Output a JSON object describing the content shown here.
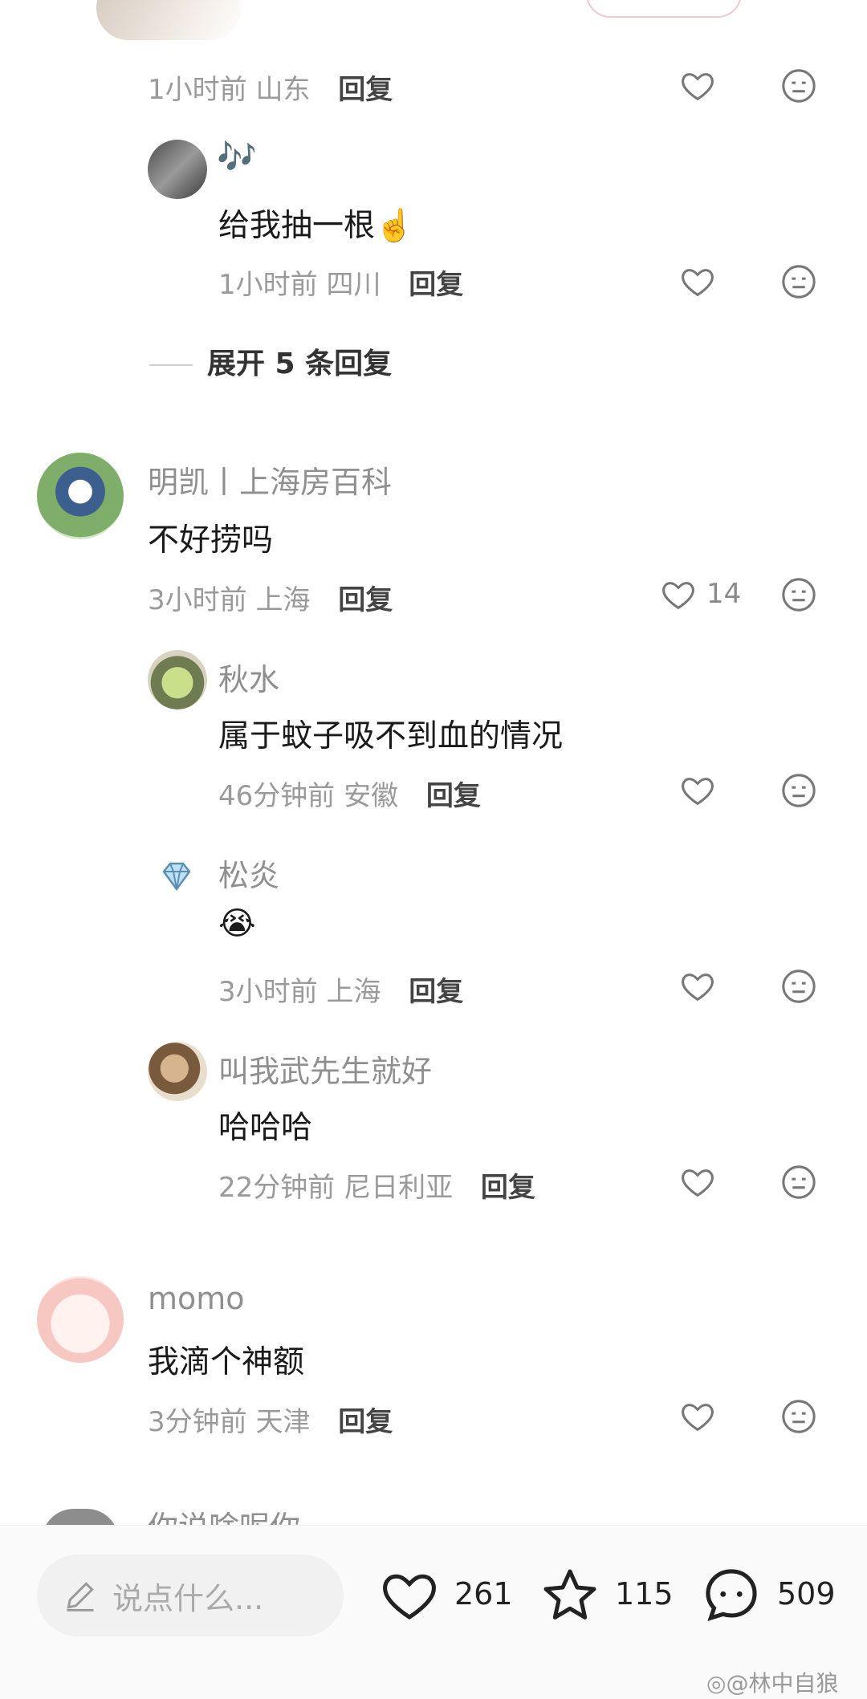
{
  "colors": {
    "reply": "#444444",
    "meta": "#9a9a9a",
    "name": "#8f8f8f",
    "accent_pink": "#f0c9cf"
  },
  "top_reply": {
    "time": "1小时前",
    "location": "山东",
    "reply_label": "回复"
  },
  "reply_smoke": {
    "name_icon": "music-notes-icon",
    "name": "🎶",
    "content": "给我抽一根☝️",
    "time": "1小时前",
    "location": "四川",
    "reply_label": "回复"
  },
  "expand": {
    "label": "展开 5 条回复"
  },
  "comment_1": {
    "name": "明凯丨上海房百科",
    "content": "不好捞吗",
    "time": "3小时前",
    "location": "上海",
    "reply_label": "回复",
    "likes": "14",
    "replies": [
      {
        "name": "秋水",
        "content": "属于蚊子吸不到血的情况",
        "time": "46分钟前",
        "location": "安徽",
        "reply_label": "回复"
      },
      {
        "name": "松炎",
        "content": "😭",
        "time": "3小时前",
        "location": "上海",
        "reply_label": "回复"
      },
      {
        "name": "叫我武先生就好",
        "content": "哈哈哈",
        "time": "22分钟前",
        "location": "尼日利亚",
        "reply_label": "回复"
      }
    ]
  },
  "comment_2": {
    "name": "momo",
    "content": "我滴个神额",
    "time": "3分钟前",
    "location": "天津",
    "reply_label": "回复"
  },
  "comment_3_partial": {
    "name": "你说啥呢你"
  },
  "bottom_bar": {
    "input_placeholder": "说点什么...",
    "likes": "261",
    "stars": "115",
    "comments": "509"
  },
  "watermark": "@林中自狼"
}
